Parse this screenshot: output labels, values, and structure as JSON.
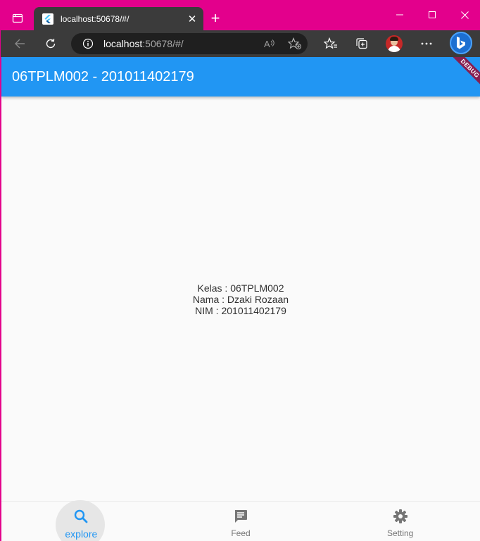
{
  "browser": {
    "tab": {
      "title": "localhost:50678/#/",
      "close_glyph": "✕"
    },
    "new_tab_glyph": "+",
    "window_controls": {
      "minimize": "—",
      "maximize": "☐",
      "close": "✕"
    },
    "address": {
      "host": "localhost",
      "rest": ":50678/#/"
    },
    "icons": [
      "tab-actions-icon",
      "flutter-favicon-icon",
      "back-icon",
      "refresh-icon",
      "info-icon",
      "read-aloud-icon",
      "add-favorite-icon",
      "favorites-icon",
      "collections-icon",
      "profile-avatar",
      "more-icon",
      "bing-icon"
    ]
  },
  "app": {
    "title": "06TPLM002 - 201011402179",
    "debug_banner": "DEBUG",
    "body_lines": [
      "Kelas : 06TPLM002",
      "Nama : Dzaki Rozaan",
      "NIM : 201011402179"
    ],
    "bottom_nav": [
      {
        "label": "explore",
        "icon": "search-icon",
        "active": true
      },
      {
        "label": "Feed",
        "icon": "chat-icon",
        "active": false
      },
      {
        "label": "Setting",
        "icon": "gear-icon",
        "active": false
      }
    ]
  },
  "colors": {
    "window_frame": "#e3008c",
    "toolbar": "#3b3b3b",
    "appbar": "#2196f3",
    "active_nav": "#2196f3",
    "inactive_nav": "#757575"
  }
}
